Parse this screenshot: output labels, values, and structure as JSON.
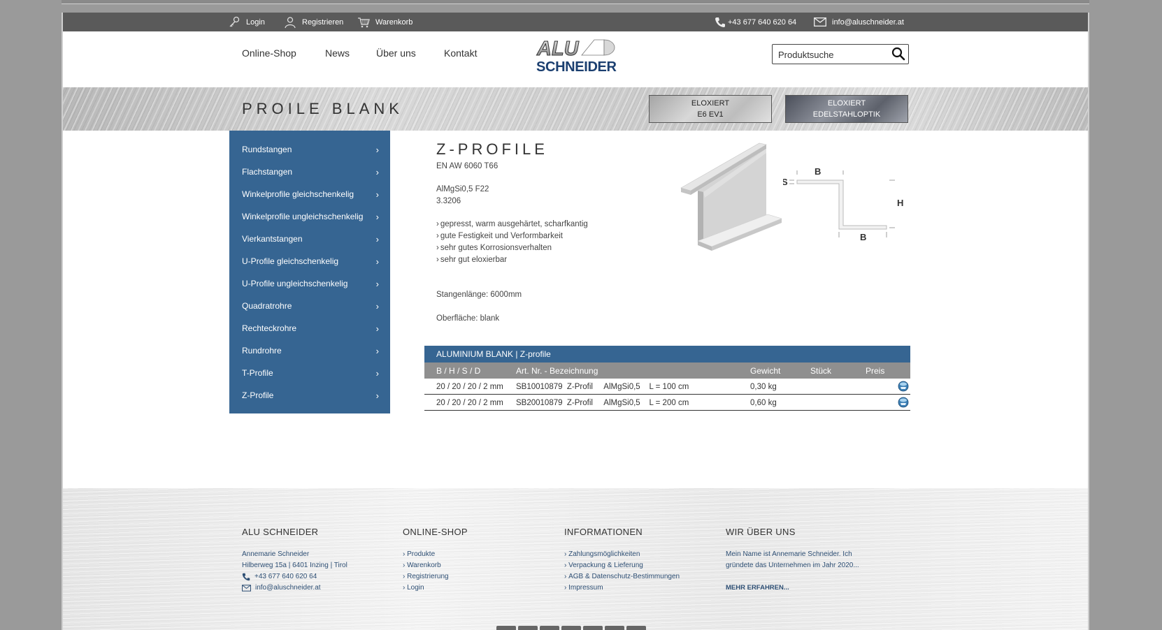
{
  "topbar": {
    "login": "Login",
    "register": "Registrieren",
    "cart": "Warenkorb",
    "phone": "+43 677 640 620 64",
    "email": "info@aluschneider.at"
  },
  "nav": {
    "items": [
      "Online-Shop",
      "News",
      "Über uns",
      "Kontakt"
    ]
  },
  "logo": {
    "line1": "ALU",
    "line2": "SCHNEIDER"
  },
  "search": {
    "placeholder": "Produktsuche"
  },
  "banner": {
    "title": "PROILE BLANK",
    "btn_e6": {
      "line1": "ELOXIERT",
      "line2": "E6 EV1"
    },
    "btn_edel": {
      "line1": "ELOXIERT",
      "line2": "EDELSTAHLOPTIK"
    }
  },
  "sidebar": {
    "items": [
      "Rundstangen",
      "Flachstangen",
      "Winkelprofile gleichschenkelig",
      "Winkelprofile ungleichschenkelig",
      "Vierkantstangen",
      "U-Profile gleichschenkelig",
      "U-Profile ungleichschenkelig",
      "Quadratrohre",
      "Rechteckrohre",
      "Rundrohre",
      "T-Profile",
      "Z-Profile"
    ],
    "chevron": "›"
  },
  "product": {
    "title": "Z-PROFILE",
    "norm": "EN AW 6060 T66",
    "alloy": "AlMgSi0,5  F22",
    "number": "3.3206",
    "features": [
      "gepresst, warm ausgehärtet, scharfkantig",
      "gute Festigkeit und Verformbarkeit",
      "sehr gutes Korrosionsverhalten",
      "sehr gut eloxierbar"
    ],
    "length": "Stangenlänge: 6000mm",
    "surface": "Oberfläche:  blank",
    "diagram_labels": {
      "s": "S",
      "b_top": "B",
      "h": "H",
      "b_bottom": "B"
    }
  },
  "table": {
    "title": "ALUMINIUM BLANK | Z-profile",
    "headers": [
      "B / H / S / D",
      "Art. Nr. - Bezeichnung",
      "Gewicht",
      "Stück",
      "Preis"
    ],
    "rows": [
      {
        "dims": "20 / 20 / 20 / 2 mm",
        "desc": "SB10010879  Z-Profil     AlMgSi0,5    L = 100 cm",
        "weight": "0,30 kg"
      },
      {
        "dims": "20 / 20 / 20 / 2 mm",
        "desc": "SB20010879  Z-Profil     AlMgSi0,5    L = 200 cm",
        "weight": "0,60 kg"
      }
    ]
  },
  "footer": {
    "col1": {
      "title": "ALU SCHNEIDER",
      "lines": [
        "Annemarie Schneider",
        "Hilberweg 15a | 6401  Inzing | Tirol",
        "+43 677 640 620 64",
        "info@aluschneider.at"
      ]
    },
    "col2": {
      "title": "ONLINE-SHOP",
      "links": [
        "Produkte",
        "Warenkorb",
        "Registrierung",
        "Login"
      ]
    },
    "col3": {
      "title": "INFORMATIONEN",
      "links": [
        "Zahlungsmöglichkeiten",
        "Verpackung & Lieferung",
        "AGB & Datenschutz-Bestimmungen",
        "Impressum"
      ]
    },
    "col4": {
      "title": "WIR ÜBER UNS",
      "text1": "Mein Name ist Annemarie Schneider. Ich",
      "text2": "gründete das Unternehmen im Jahr 2020...",
      "more": "MEHR ERFAHREN..."
    }
  },
  "colors": {
    "accent": "#366592",
    "topbar": "#5a5a5a",
    "table_header": "#8f8f8f"
  }
}
